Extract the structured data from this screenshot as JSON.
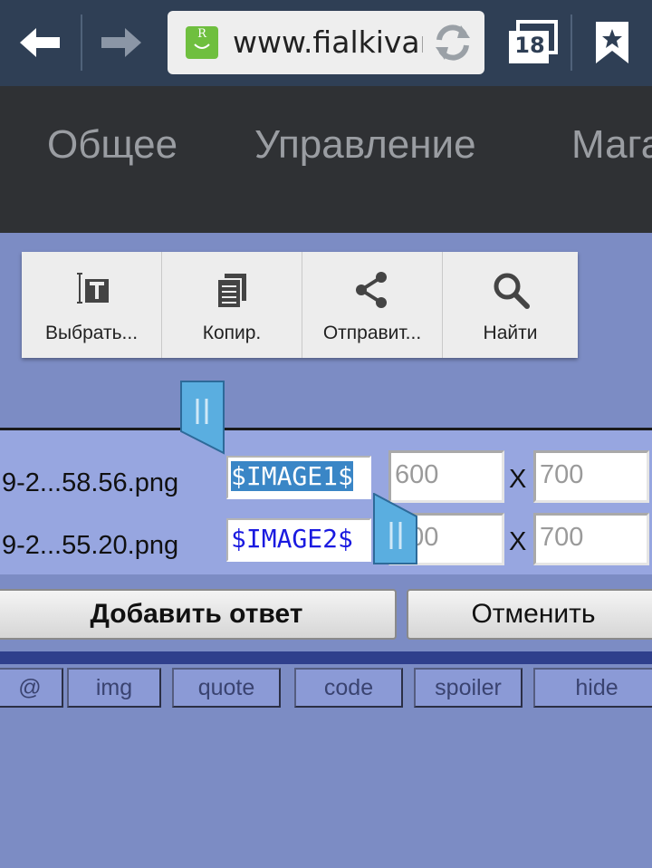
{
  "browser": {
    "url": "www.fialkivard.ru",
    "tab_count": "18",
    "site_logo_letter": "R"
  },
  "site_nav": {
    "items": [
      "Общее",
      "Управление",
      "Магазин"
    ]
  },
  "context_menu": {
    "items": [
      {
        "label": "Выбрать...",
        "icon": "select-text-icon"
      },
      {
        "label": "Копир.",
        "icon": "copy-icon"
      },
      {
        "label": "Отправит...",
        "icon": "share-icon"
      },
      {
        "label": "Найти",
        "icon": "search-icon"
      }
    ]
  },
  "attachments": [
    {
      "filename": "9-2...58.56.png",
      "token": "$IMAGE1$",
      "width": "600",
      "height": "700"
    },
    {
      "filename": "9-2...55.20.png",
      "token": "$IMAGE2$",
      "width": "600",
      "height": "700"
    }
  ],
  "dim_separator": "X",
  "actions": {
    "submit_label": "Добавить ответ",
    "cancel_label": "Отменить"
  },
  "bbcode": [
    "@",
    "img",
    "quote",
    "code",
    "spoiler",
    "hide"
  ],
  "colors": {
    "toolbar": "#2f3f55",
    "nav_bg": "#2f3134",
    "page_bg": "#7c8cc4",
    "selection": "#3a86c6",
    "handle": "#5aaee0"
  }
}
